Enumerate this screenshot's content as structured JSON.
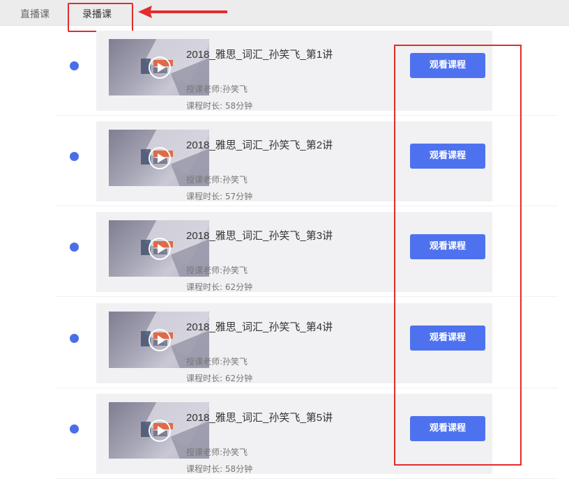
{
  "tabs": {
    "live_label": "直播课",
    "recorded_label": "录播课"
  },
  "courses": [
    {
      "title": "2018_雅思_词汇_孙笑飞_第1讲",
      "teacher": "授课老师:孙笑飞",
      "duration": "课程时长: 58分钟",
      "button": "观看课程"
    },
    {
      "title": "2018_雅思_词汇_孙笑飞_第2讲",
      "teacher": "授课老师:孙笑飞",
      "duration": "课程时长: 57分钟",
      "button": "观看课程"
    },
    {
      "title": "2018_雅思_词汇_孙笑飞_第3讲",
      "teacher": "授课老师:孙笑飞",
      "duration": "课程时长: 62分钟",
      "button": "观看课程"
    },
    {
      "title": "2018_雅思_词汇_孙笑飞_第4讲",
      "teacher": "授课老师:孙笑飞",
      "duration": "课程时长: 62分钟",
      "button": "观看课程"
    },
    {
      "title": "2018_雅思_词汇_孙笑飞_第5讲",
      "teacher": "授课老师:孙笑飞",
      "duration": "课程时长: 58分钟",
      "button": "观看课程"
    }
  ],
  "icons": {
    "play": "play-circle-icon",
    "status": "dot-icon",
    "annotation_arrow": "arrow-left-icon"
  },
  "colors": {
    "accent": "#4e72ef",
    "dot": "#4b6ee8",
    "annotation": "#e32b2b"
  }
}
